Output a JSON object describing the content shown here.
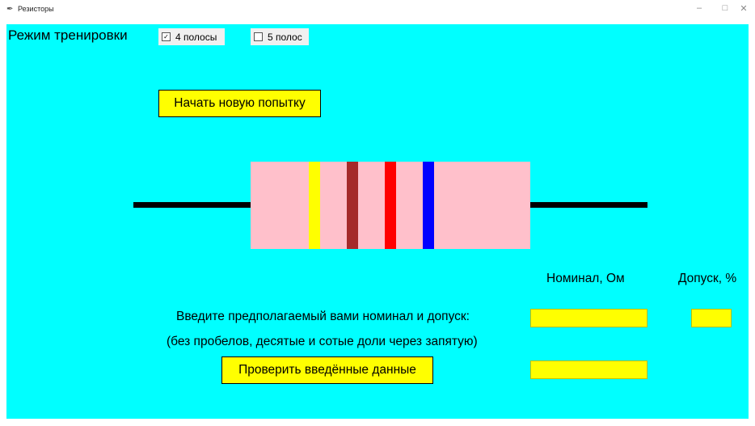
{
  "window": {
    "title": "Резисторы",
    "controls": [
      "–",
      "□",
      "✕"
    ]
  },
  "mode": {
    "label": "Режим тренировки",
    "options": [
      {
        "label": "4 полосы",
        "checked": true
      },
      {
        "label": "5 полос",
        "checked": false
      }
    ]
  },
  "buttons": {
    "new_attempt": "Начать новую попытку",
    "check": "Проверить введённые данные"
  },
  "resistor": {
    "band_colors": [
      "#ffff00",
      "#a52a2a",
      "#ff0000",
      "#0000ff"
    ],
    "body_color": "#ffc0cb",
    "lead_color": "#000000"
  },
  "columns": {
    "nominal": "Номинал, Ом",
    "tolerance": "Допуск, %"
  },
  "instructions": {
    "line1": "Введите предполагаемый вами номинал и допуск:",
    "line2": "(без пробелов, десятые и сотые доли через запятую)"
  },
  "inputs": {
    "nominal_value": "",
    "tolerance_value": "",
    "result_value": ""
  },
  "colors": {
    "background": "#00ffff",
    "accent": "#ffff00"
  }
}
